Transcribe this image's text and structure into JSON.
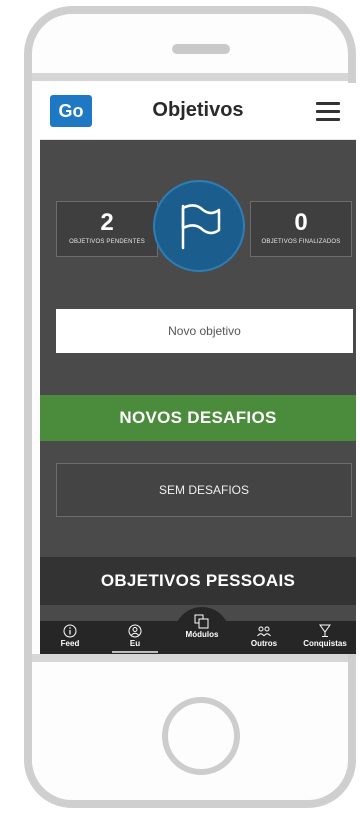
{
  "app": {
    "logo": "Go",
    "title": "Objetivos"
  },
  "stats": {
    "pending_count": "2",
    "pending_label": "OBJETIVOS PENDENTES",
    "finished_count": "0",
    "finished_label": "OBJETIVOS FINALIZADOS"
  },
  "new_goal": {
    "label": "Novo objetivo"
  },
  "challenges": {
    "header": "NOVOS DESAFIOS",
    "empty_label": "SEM DESAFIOS"
  },
  "personal": {
    "header": "OBJETIVOS PESSOAIS"
  },
  "tabs": [
    {
      "label": "Feed",
      "icon": "info-circle-icon"
    },
    {
      "label": "Eu",
      "icon": "user-icon"
    },
    {
      "label": "Módulos",
      "icon": "modules-icon"
    },
    {
      "label": "Outros",
      "icon": "users-icon"
    },
    {
      "label": "Conquistas",
      "icon": "trophy-icon"
    }
  ],
  "colors": {
    "brand": "#1f78c3",
    "flag_circle": "#1b5e8e",
    "challenges_green": "#4a8b3c",
    "screen_bg": "#4a4a4a"
  }
}
